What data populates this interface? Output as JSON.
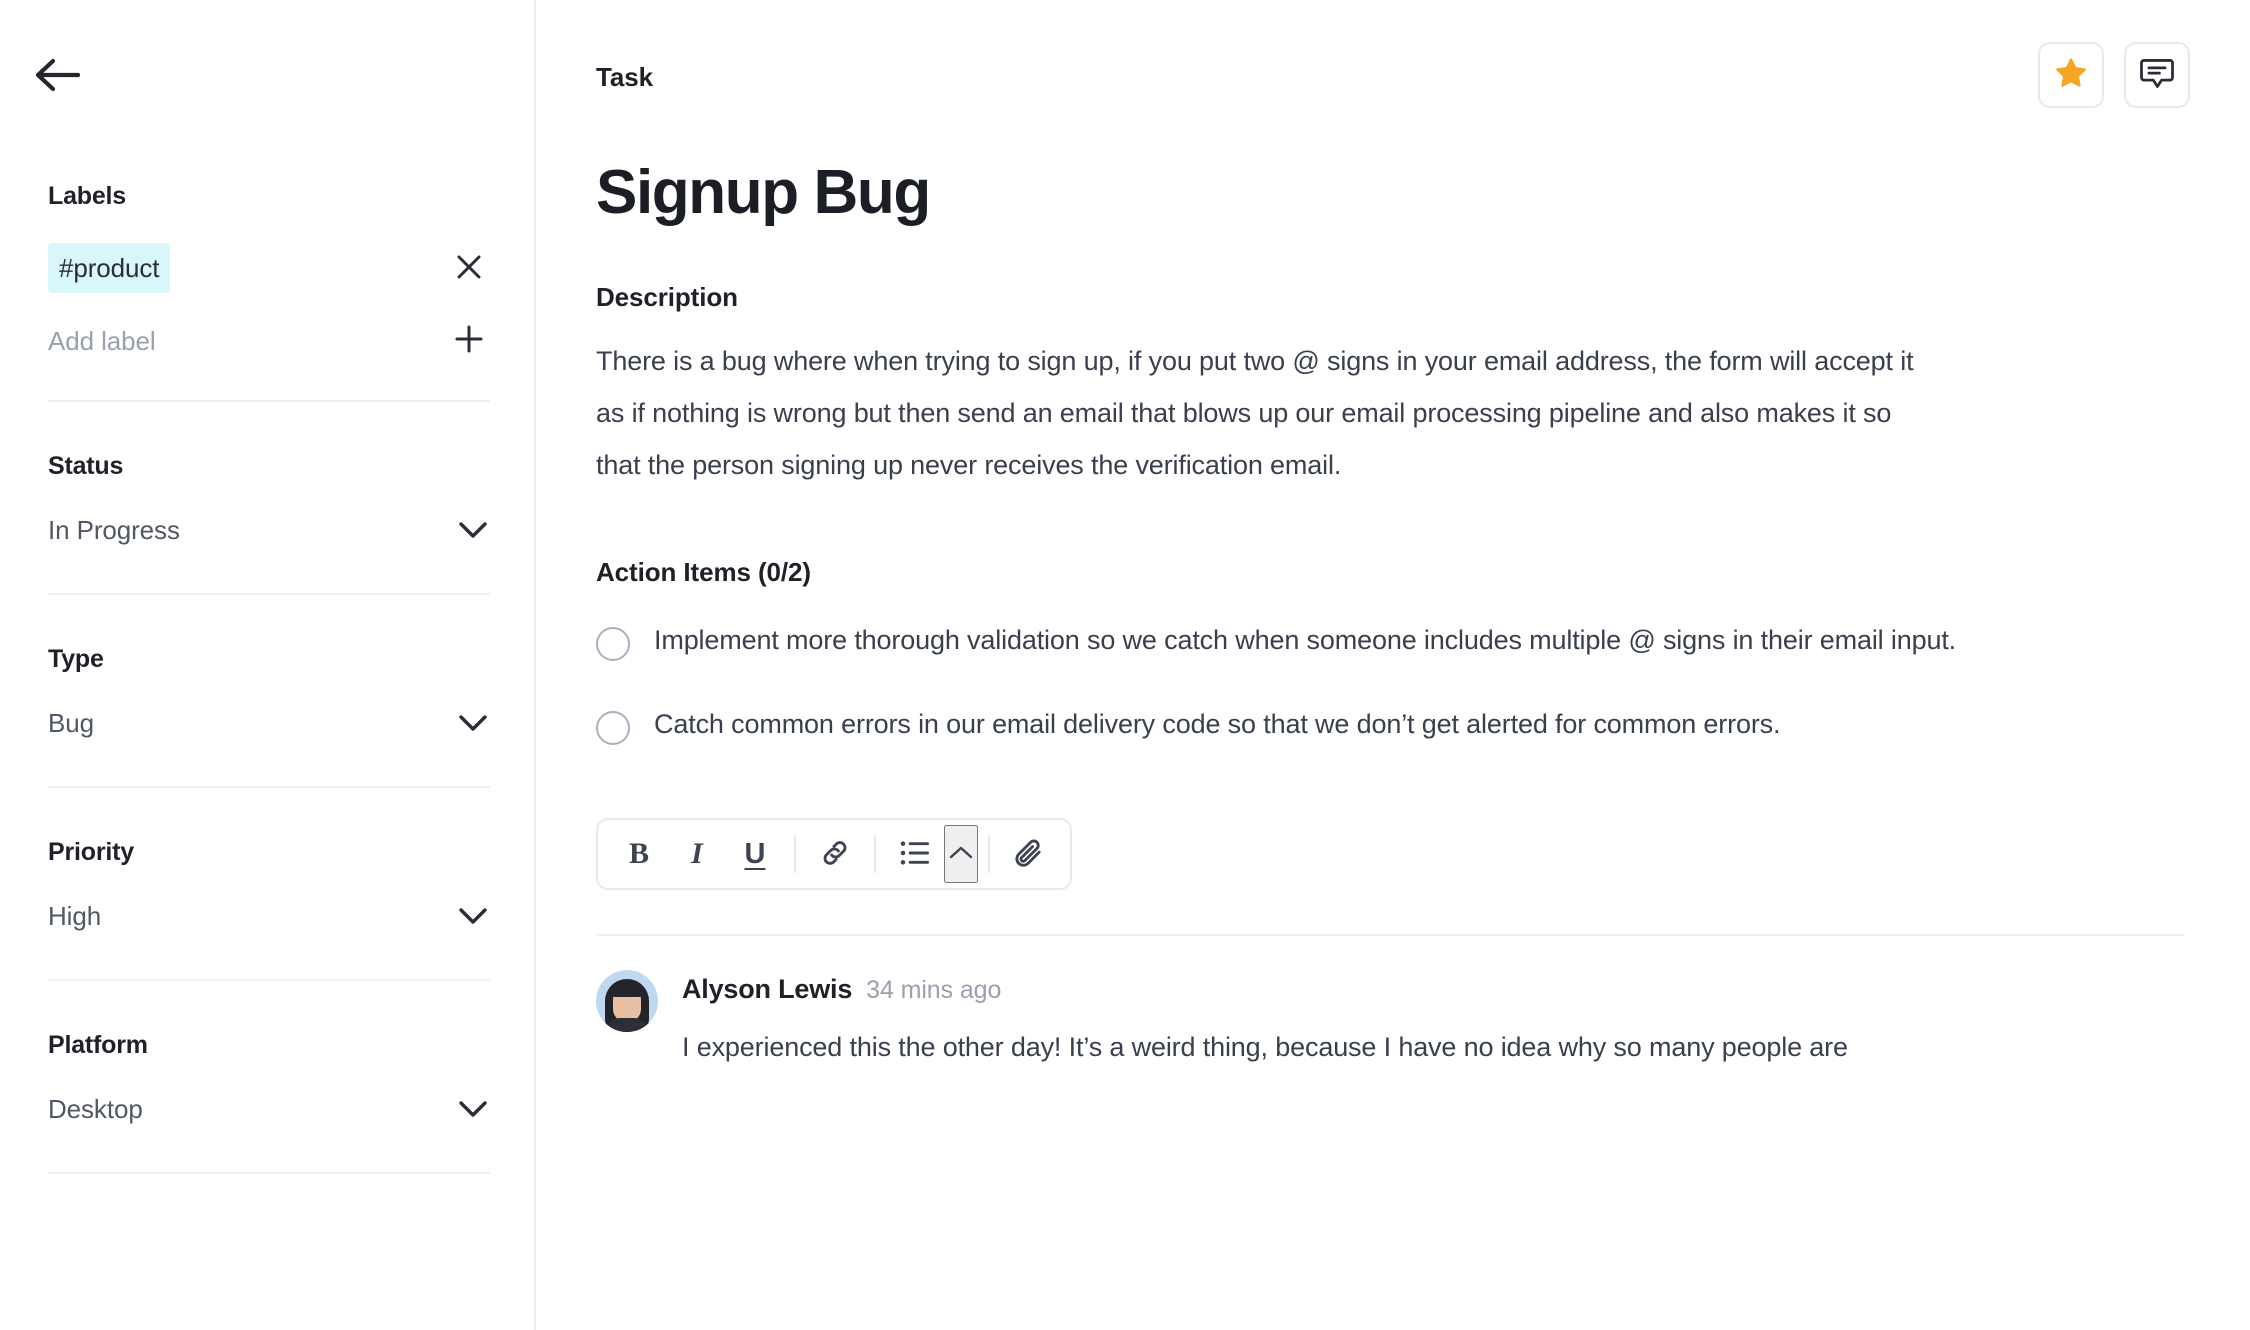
{
  "sidebar": {
    "back_icon": "arrow-left-icon",
    "labels": {
      "title": "Labels",
      "chips": [
        {
          "text": "#product",
          "remove_icon": "close-icon",
          "bg": "#d9f6fb"
        }
      ],
      "add_placeholder": "Add label",
      "add_icon": "plus-icon"
    },
    "fields": [
      {
        "title": "Status",
        "value": "In Progress",
        "icon": "chevron-down-icon"
      },
      {
        "title": "Type",
        "value": "Bug",
        "icon": "chevron-down-icon"
      },
      {
        "title": "Priority",
        "value": "High",
        "icon": "chevron-down-icon"
      },
      {
        "title": "Platform",
        "value": "Desktop",
        "icon": "chevron-down-icon"
      }
    ]
  },
  "main": {
    "kicker": "Task",
    "title": "Signup Bug",
    "header_actions": [
      {
        "name": "favorite-button",
        "icon": "star-icon",
        "color": "#f5a623",
        "active": true
      },
      {
        "name": "comment-button",
        "icon": "comment-icon",
        "color": "#2b2d36",
        "active": false
      }
    ],
    "description": {
      "label": "Description",
      "text": "There is a bug where when trying to sign up, if you put two @ signs in your email address, the form will accept it as if nothing is wrong but then send an email that blows up our email processing pipeline and also makes it so that the person signing up never receives the verification email."
    },
    "action_items": {
      "label": "Action Items (0/2)",
      "completed": 0,
      "total": 2,
      "items": [
        {
          "text": "Implement more thorough validation so we catch when someone includes multiple @ signs in their email input.",
          "checked": false
        },
        {
          "text": "Catch common errors in our email delivery code so that we don’t get alerted for common errors.",
          "checked": false
        }
      ]
    },
    "editor_toolbar": [
      {
        "name": "bold-button",
        "label": "B",
        "icon": "bold-icon"
      },
      {
        "name": "italic-button",
        "label": "I",
        "icon": "italic-icon"
      },
      {
        "name": "underline-button",
        "label": "U",
        "icon": "underline-icon"
      },
      {
        "name": "link-button",
        "label": "",
        "icon": "link-icon"
      },
      {
        "name": "bullet-list-button",
        "label": "",
        "icon": "bullet-list-icon"
      },
      {
        "name": "list-options-button",
        "label": "",
        "icon": "chevron-up-icon"
      },
      {
        "name": "attachment-button",
        "label": "",
        "icon": "paperclip-icon"
      }
    ],
    "comments": [
      {
        "author": "Alyson Lewis",
        "time": "34 mins ago",
        "body": "I experienced this the other day! It’s a weird thing, because I have no idea why so many people are",
        "avatar": "user-avatar"
      }
    ]
  }
}
